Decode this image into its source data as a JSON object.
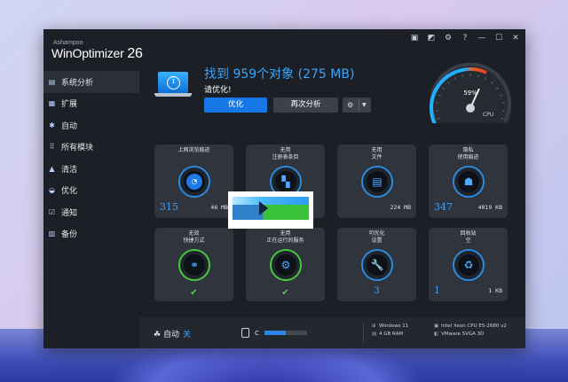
{
  "app": {
    "brand": "Ashampoo",
    "name": "WinOptimizer",
    "version": "26"
  },
  "titlebar": {
    "icons": [
      "chat-icon",
      "chart-icon",
      "gear-icon",
      "help-icon",
      "minimize-icon",
      "maximize-icon",
      "close-icon"
    ],
    "glyphs": [
      "▣",
      "◩",
      "⚙",
      "?",
      "—",
      "☐",
      "✕"
    ]
  },
  "sidebar": {
    "items": [
      {
        "label": "系统分析",
        "icon": "▤",
        "name": "analysis"
      },
      {
        "label": "扩展",
        "icon": "▦",
        "name": "extension"
      },
      {
        "label": "自动",
        "icon": "✱",
        "name": "auto"
      },
      {
        "label": "所有模块",
        "icon": "⠿",
        "name": "all-modules"
      },
      {
        "label": "清洁",
        "icon": "▲",
        "name": "clean"
      },
      {
        "label": "优化",
        "icon": "◒",
        "name": "optimize"
      },
      {
        "label": "通知",
        "icon": "☑",
        "name": "notify"
      },
      {
        "label": "备份",
        "icon": "▥",
        "name": "backup"
      }
    ]
  },
  "header": {
    "title": "找到 959个对象 (275 MB)",
    "subtitle": "请优化!",
    "optimize_label": "优化",
    "reanalyze_label": "再次分析",
    "gear_glyph": "⚙",
    "caret_glyph": "▼"
  },
  "gauge": {
    "value_label": "59%",
    "value": 59,
    "caption": "CPU"
  },
  "tiles": [
    {
      "name": "browsing-traces",
      "label": "上网浏览痕迹",
      "icon": "compass-icon",
      "glyph": "◔",
      "ring": "blue",
      "big": "315",
      "small": "46 MB"
    },
    {
      "name": "registry",
      "label": "无用\n注册表条目",
      "icon": "registry-icon",
      "glyph": "▚",
      "ring": "blue",
      "big": "",
      "small": ""
    },
    {
      "name": "junk-files",
      "label": "无用\n文件",
      "icon": "file-icon",
      "glyph": "▤",
      "ring": "blue",
      "big": "",
      "small": "224 MB"
    },
    {
      "name": "privacy-traces",
      "label": "隐私\n使用痕迹",
      "icon": "user-shield-icon",
      "glyph": "☗",
      "ring": "blue",
      "big": "347",
      "small": "4019 KB"
    },
    {
      "name": "invalid-shortcuts",
      "label": "无效\n快捷方式",
      "icon": "broken-link-icon",
      "glyph": "⚭",
      "ring": "green",
      "check": "✔"
    },
    {
      "name": "running-services",
      "label": "无用\n正在运行的服务",
      "icon": "gears-icon",
      "glyph": "⚙",
      "ring": "green",
      "check": "✔"
    },
    {
      "name": "optimizable-settings",
      "label": "可优化\n设置",
      "icon": "wrench-icon",
      "glyph": "🔧",
      "ring": "blue",
      "mid": "3"
    },
    {
      "name": "recycle-bin",
      "label": "回收站\n空",
      "icon": "recycle-bin-icon",
      "glyph": "♻",
      "ring": "blue",
      "big": "1",
      "small": "1 KB"
    }
  ],
  "footer": {
    "auto_label": "自动",
    "auto_state": "关",
    "drive_label": "C",
    "drive_fill_percent": 50,
    "os": "Windows 11",
    "ram": "4 GB RAM",
    "cpu": "Intel Xeon CPU E5-2680 v2",
    "gpu": "VMware SVGA 3D"
  }
}
